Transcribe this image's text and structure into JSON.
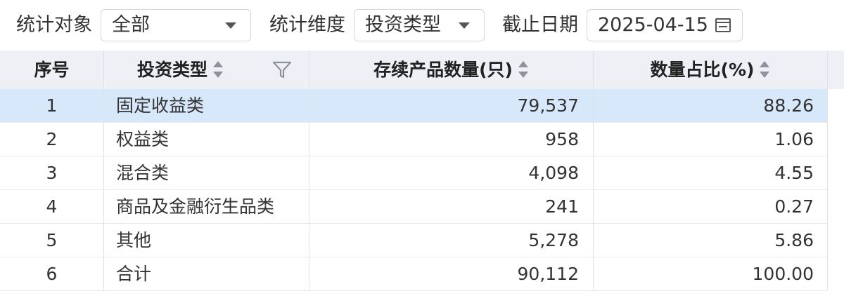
{
  "filters": {
    "object_label": "统计对象",
    "object_value": "全部",
    "dimension_label": "统计维度",
    "dimension_value": "投资类型",
    "date_label": "截止日期",
    "date_value": "2025-04-15"
  },
  "table": {
    "headers": {
      "index": "序号",
      "type": "投资类型",
      "count": "存续产品数量(只)",
      "ratio": "数量占比(%)"
    },
    "selected_row": 0,
    "rows": [
      {
        "index": "1",
        "type": "固定收益类",
        "count": "79,537",
        "ratio": "88.26"
      },
      {
        "index": "2",
        "type": "权益类",
        "count": "958",
        "ratio": "1.06"
      },
      {
        "index": "3",
        "type": "混合类",
        "count": "4,098",
        "ratio": "4.55"
      },
      {
        "index": "4",
        "type": "商品及金融衍生品类",
        "count": "241",
        "ratio": "0.27"
      },
      {
        "index": "5",
        "type": "其他",
        "count": "5,278",
        "ratio": "5.86"
      },
      {
        "index": "6",
        "type": "合计",
        "count": "90,112",
        "ratio": "100.00"
      }
    ]
  },
  "colors": {
    "header_bg": "#eef0f5",
    "selected_row_bg": "#d8e8fb",
    "border": "#dfe2ea"
  }
}
